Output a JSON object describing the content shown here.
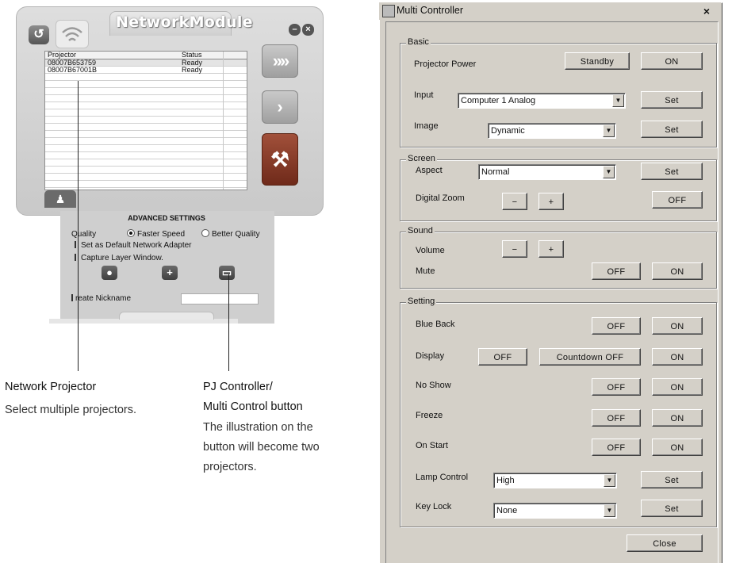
{
  "network_module": {
    "title": "NetworkModule",
    "list": {
      "headers": [
        "Projector",
        "Status"
      ],
      "rows": [
        [
          "08007B653759",
          "Ready"
        ],
        [
          "08007B67001B",
          "Ready"
        ]
      ]
    },
    "advanced": {
      "title": "ADVANCED SETTINGS",
      "quality_label": "Quality",
      "faster_label": "Faster Speed",
      "better_label": "Better Quality",
      "default_adapter": "Set as Default Network Adapter",
      "capture_layer": "Capture Layer Window.",
      "nickname_label": "reate Nickname"
    },
    "icons": [
      "refresh-icon",
      "wifi-icon",
      "minimize-icon",
      "close-icon",
      "fast-forward-icon",
      "next-icon",
      "tools-icon",
      "person-icon",
      "record-icon",
      "plus-icon",
      "multi-control-icon"
    ]
  },
  "callouts": {
    "network_projector_title": "Network Projector",
    "network_projector_desc": "Select multiple projectors.",
    "pj_controller_title_1": "PJ Controller/",
    "pj_controller_title_2": "Multi Control button",
    "pj_controller_desc_1": "The illustration on the",
    "pj_controller_desc_2": "button will become two",
    "pj_controller_desc_3": "projectors."
  },
  "multi_controller": {
    "title": "Multi Controller",
    "close_x": "×",
    "basic": {
      "title": "Basic",
      "power_label": "Projector Power",
      "standby": "Standby",
      "on": "ON",
      "input_label": "Input",
      "input_value": "Computer 1  Analog",
      "set": "Set",
      "image_label": "Image",
      "image_value": "Dynamic"
    },
    "screen": {
      "title": "Screen",
      "aspect_label": "Aspect",
      "aspect_value": "Normal",
      "set": "Set",
      "zoom_label": "Digital Zoom",
      "minus": "−",
      "plus": "+",
      "off": "OFF"
    },
    "sound": {
      "title": "Sound",
      "volume_label": "Volume",
      "minus": "−",
      "plus": "+",
      "mute_label": "Mute",
      "off": "OFF",
      "on": "ON"
    },
    "setting": {
      "title": "Setting",
      "blue_back": "Blue Back",
      "display": "Display",
      "no_show": "No Show",
      "freeze": "Freeze",
      "on_start": "On Start",
      "lamp_control": "Lamp Control",
      "lamp_value": "High",
      "key_lock": "Key Lock",
      "key_value": "None",
      "off": "OFF",
      "on": "ON",
      "countdown_off": "Countdown OFF",
      "set": "Set"
    },
    "close_button": "Close"
  }
}
